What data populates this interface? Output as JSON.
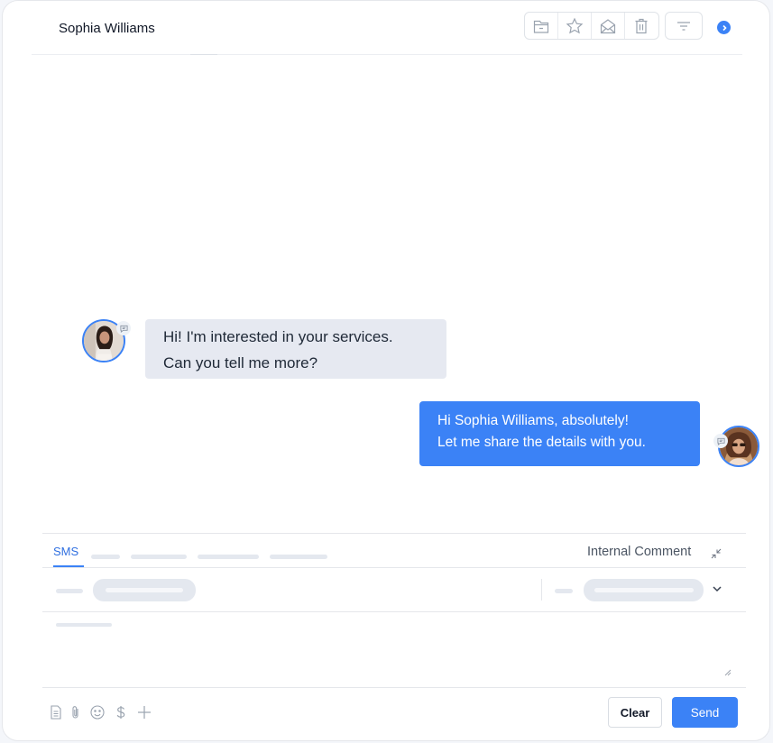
{
  "header": {
    "contact_name": "Sophia Williams",
    "toolbar_icons": [
      "archive-icon",
      "star-icon",
      "mark-unread-icon",
      "trash-icon"
    ],
    "filter_icon": "filter-icon",
    "next_icon": "chevron-right-icon"
  },
  "messages": [
    {
      "direction": "inbound",
      "channel": "SMS",
      "lines": [
        "Hi! I'm interested in your services.",
        "Can you tell me more?"
      ]
    },
    {
      "direction": "outbound",
      "channel": "SMS",
      "lines": [
        "Hi Sophia Williams, absolutely!",
        "Let me share the details with you."
      ]
    }
  ],
  "composer": {
    "tabs": {
      "active": "SMS",
      "internal_comment": "Internal Comment"
    },
    "bottom_icons": [
      "document-icon",
      "paperclip-icon",
      "emoji-icon",
      "dollar-icon",
      "plus-icon"
    ],
    "clear_label": "Clear",
    "send_label": "Send"
  },
  "colors": {
    "accent": "#3b82f6",
    "inbound_bubble": "#e6e9f1",
    "skeleton": "#e4e8ef"
  }
}
